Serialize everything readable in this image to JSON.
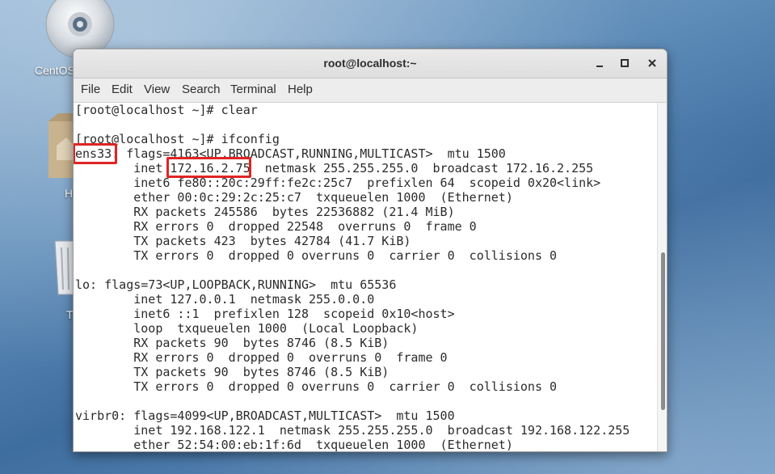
{
  "desktop": {
    "icons": [
      {
        "label": "CentOS"
      },
      {
        "label": "H"
      },
      {
        "label": "T"
      }
    ]
  },
  "window": {
    "title": "root@localhost:~",
    "controls": {
      "minimize": "_",
      "maximize": "□",
      "close": "✕"
    },
    "menu": [
      "File",
      "Edit",
      "View",
      "Search",
      "Terminal",
      "Help"
    ]
  },
  "terminal": {
    "lines": [
      "[root@localhost ~]# clear",
      "",
      "[root@localhost ~]# ifconfig",
      "ens33: flags=4163<UP,BROADCAST,RUNNING,MULTICAST>  mtu 1500",
      "        inet 172.16.2.75  netmask 255.255.255.0  broadcast 172.16.2.255",
      "        inet6 fe80::20c:29ff:fe2c:25c7  prefixlen 64  scopeid 0x20<link>",
      "        ether 00:0c:29:2c:25:c7  txqueuelen 1000  (Ethernet)",
      "        RX packets 245586  bytes 22536882 (21.4 MiB)",
      "        RX errors 0  dropped 22548  overruns 0  frame 0",
      "        TX packets 423  bytes 42784 (41.7 KiB)",
      "        TX errors 0  dropped 0 overruns 0  carrier 0  collisions 0",
      "",
      "lo: flags=73<UP,LOOPBACK,RUNNING>  mtu 65536",
      "        inet 127.0.0.1  netmask 255.0.0.0",
      "        inet6 ::1  prefixlen 128  scopeid 0x10<host>",
      "        loop  txqueuelen 1000  (Local Loopback)",
      "        RX packets 90  bytes 8746 (8.5 KiB)",
      "        RX errors 0  dropped 0  overruns 0  frame 0",
      "        TX packets 90  bytes 8746 (8.5 KiB)",
      "        TX errors 0  dropped 0 overruns 0  carrier 0  collisions 0",
      "",
      "virbr0: flags=4099<UP,BROADCAST,MULTICAST>  mtu 1500",
      "        inet 192.168.122.1  netmask 255.255.255.0  broadcast 192.168.122.255",
      "        ether 52:54:00:eb:1f:6d  txqueuelen 1000  (Ethernet)"
    ]
  },
  "colors": {
    "highlight_box": "#e02424",
    "terminal_text": "#2b2b2b",
    "terminal_bg": "#ffffff"
  }
}
